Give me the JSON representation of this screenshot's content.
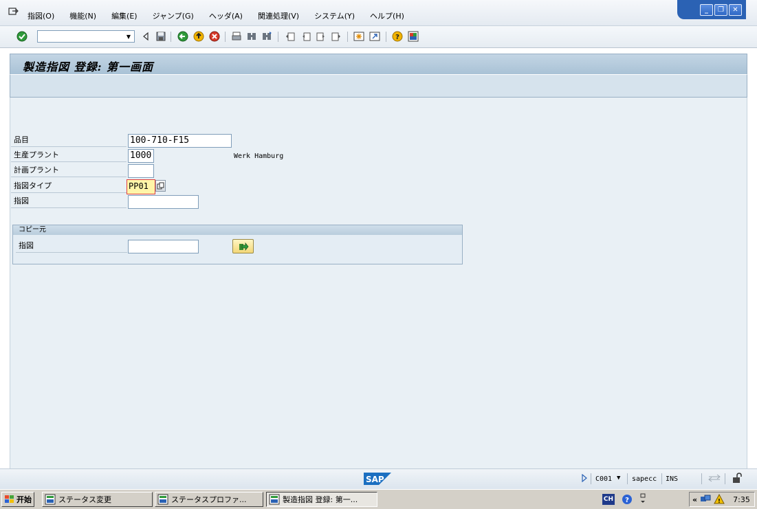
{
  "menubar": {
    "items": [
      "指図(O)",
      "機能(N)",
      "編集(E)",
      "ジャンプ(G)",
      "ヘッダ(A)",
      "関連処理(V)",
      "システム(Y)",
      "ヘルプ(H)"
    ]
  },
  "window_controls": {
    "minimize": "_",
    "restore": "❐",
    "close": "✕"
  },
  "toolbar": {
    "command_field_value": ""
  },
  "title": {
    "text": "製造指図 登録: 第一画面"
  },
  "form": {
    "material": {
      "label": "品目",
      "value": "100-710-F15"
    },
    "production_plant": {
      "label": "生産プラント",
      "value": "1000",
      "description": "Werk Hamburg"
    },
    "planning_plant": {
      "label": "計画プラント",
      "value": ""
    },
    "order_type": {
      "label": "指図タイプ",
      "value": "PP01"
    },
    "order": {
      "label": "指図",
      "value": ""
    }
  },
  "copy_from": {
    "title": "コピー元",
    "order": {
      "label": "指図",
      "value": ""
    }
  },
  "statusbar": {
    "logo": "SAP",
    "client": "C001",
    "server": "sapecc",
    "mode": "INS"
  },
  "taskbar": {
    "start_label": "开始",
    "tasks": [
      "ステータス変更",
      "ステータスプロファ...",
      "製造指図 登録: 第一..."
    ],
    "lang": "CH",
    "time": "7:35"
  },
  "colors": {
    "accent": "#2b62b4",
    "title_bg": "#b6cbdc",
    "focus_field": "#fff5a8"
  }
}
